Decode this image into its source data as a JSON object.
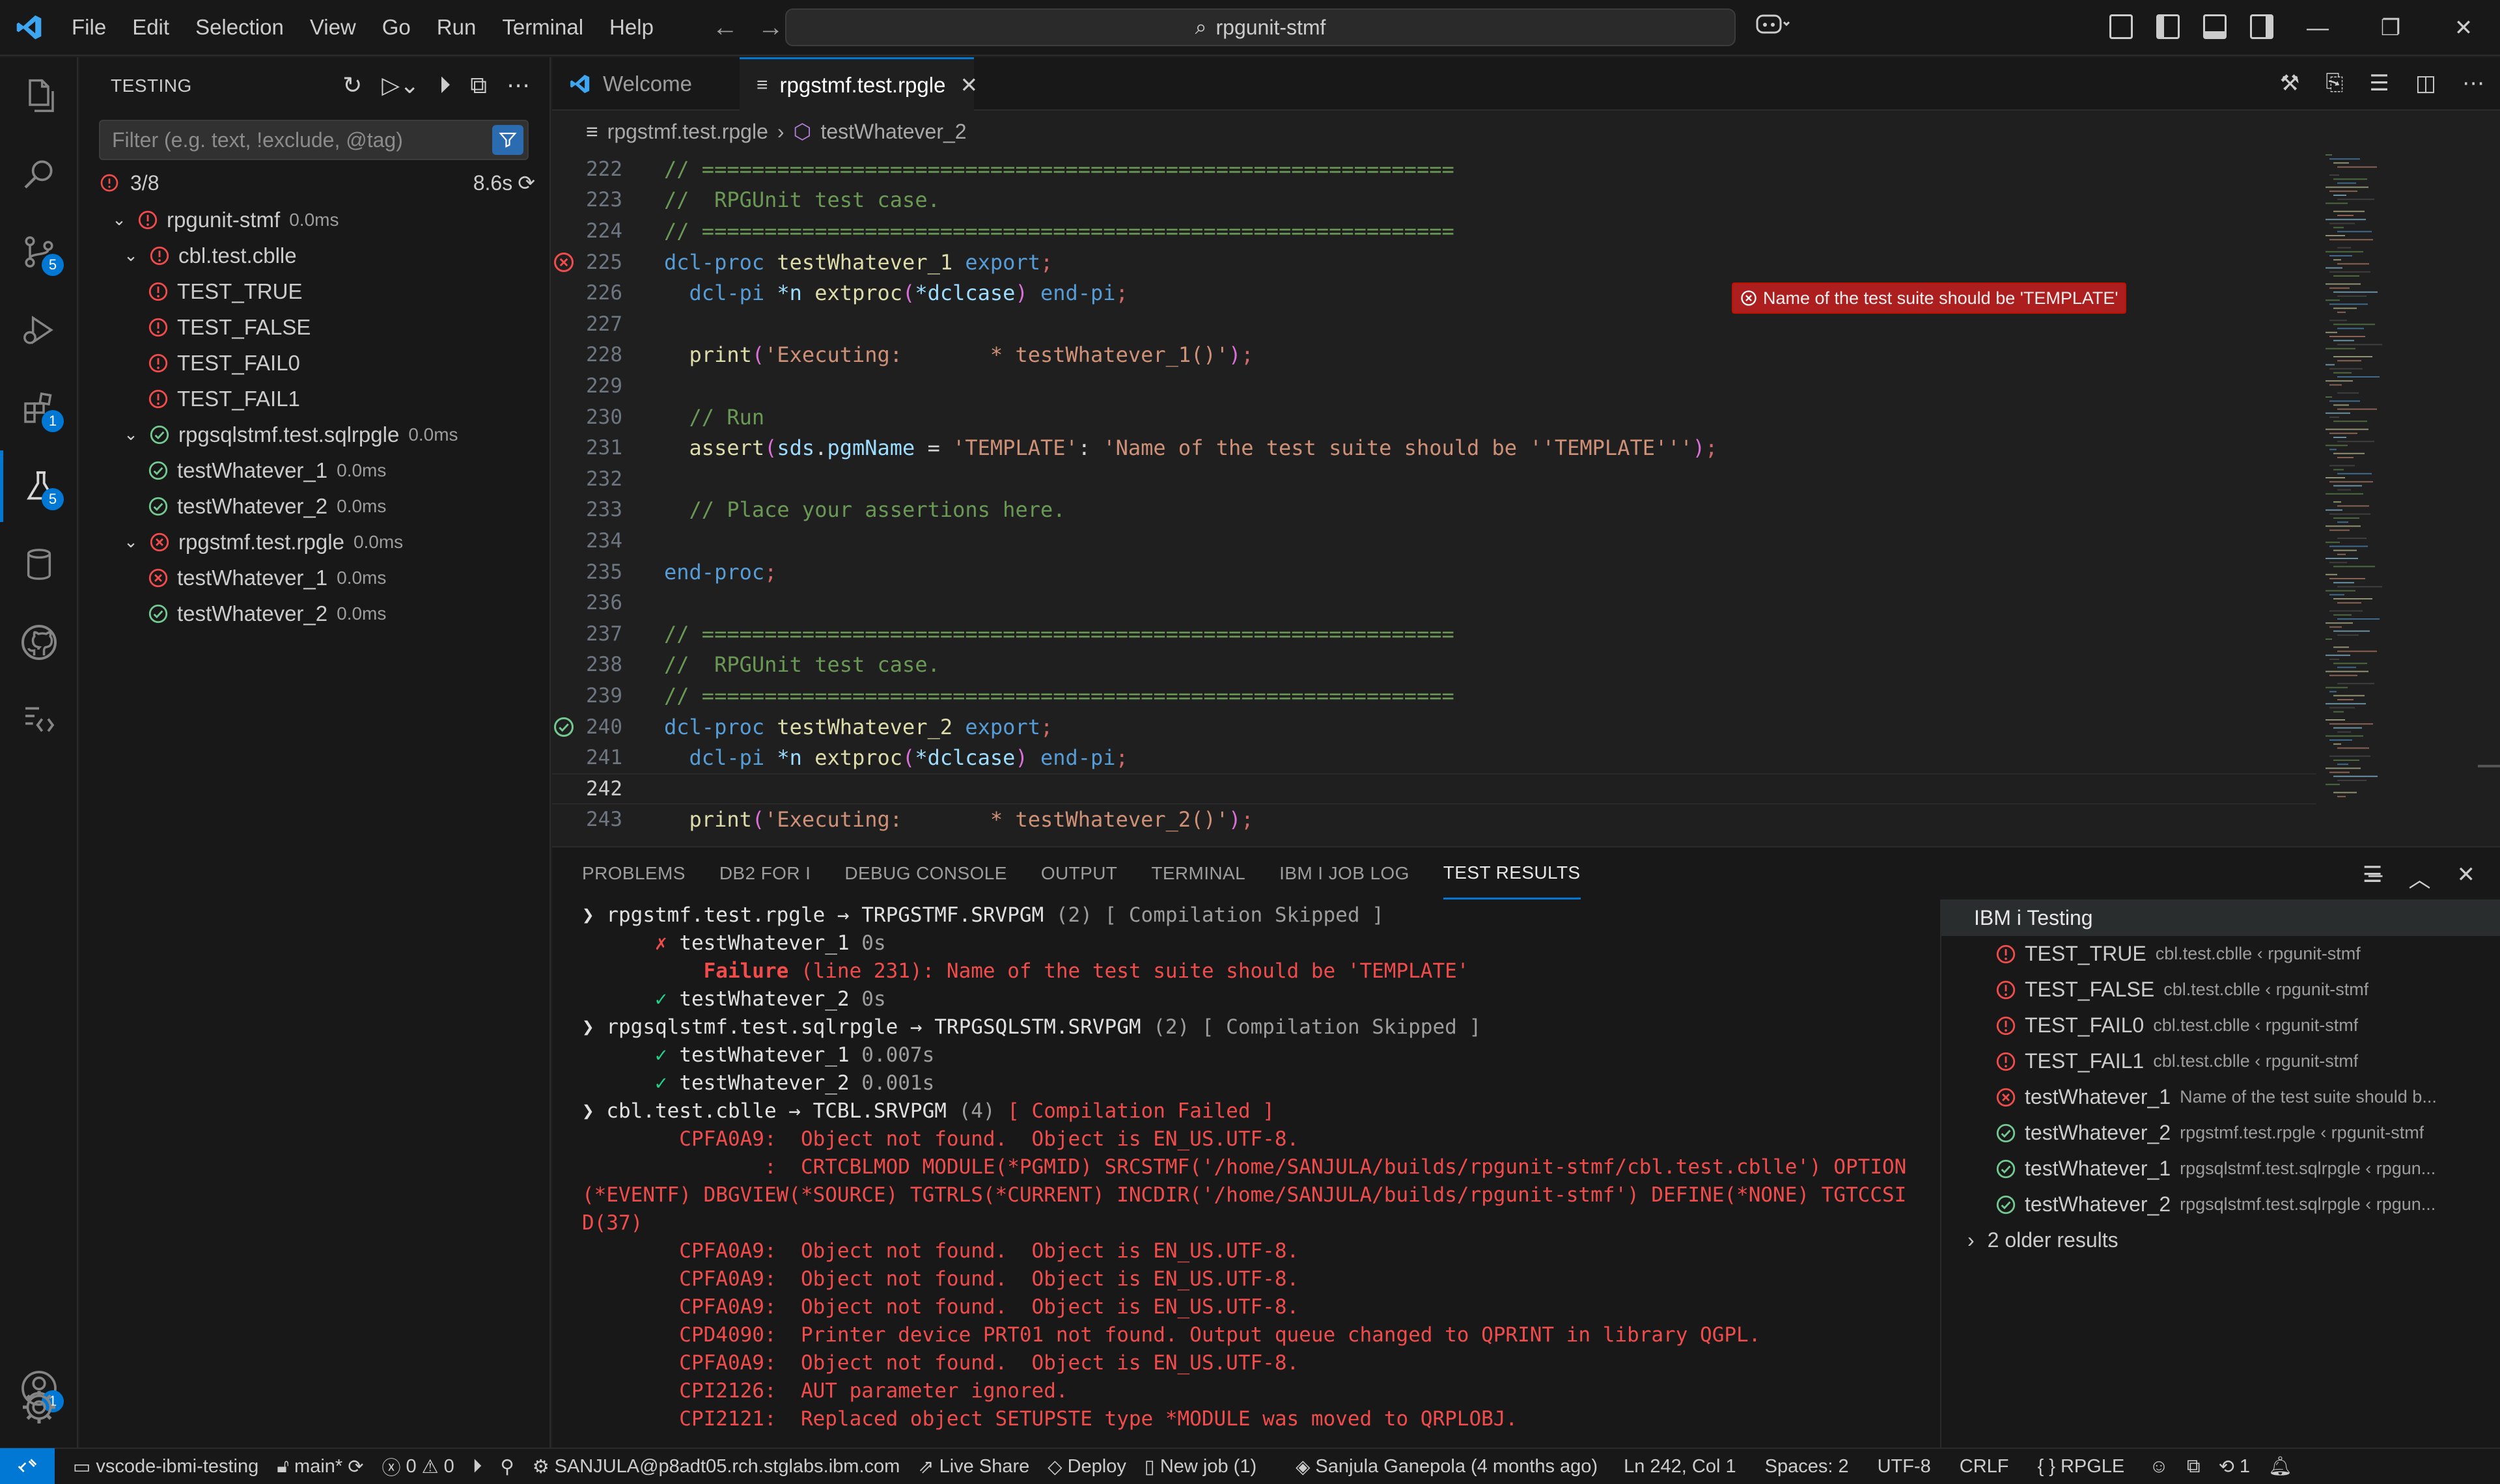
{
  "titlebar": {
    "menu": [
      "File",
      "Edit",
      "Selection",
      "View",
      "Go",
      "Run",
      "Terminal",
      "Help"
    ],
    "search": "rpgunit-stmf"
  },
  "activity": {
    "badges": {
      "scm": "5",
      "extensions": "1",
      "testing": "5",
      "accounts": "1"
    }
  },
  "sidebar": {
    "title": "TESTING",
    "filter_placeholder": "Filter (e.g. text, !exclude, @tag)",
    "summary_count": "3/8",
    "summary_time": "8.6s",
    "tree": [
      {
        "label": "rpgunit-stmf",
        "dur": "0.0ms",
        "status": "error",
        "level": 0,
        "chev": "v"
      },
      {
        "label": "cbl.test.cblle",
        "dur": "",
        "status": "error",
        "level": 1,
        "chev": "v"
      },
      {
        "label": "TEST_TRUE",
        "dur": "",
        "status": "error",
        "level": 2,
        "chev": ""
      },
      {
        "label": "TEST_FALSE",
        "dur": "",
        "status": "error",
        "level": 2,
        "chev": ""
      },
      {
        "label": "TEST_FAIL0",
        "dur": "",
        "status": "error",
        "level": 2,
        "chev": ""
      },
      {
        "label": "TEST_FAIL1",
        "dur": "",
        "status": "error",
        "level": 2,
        "chev": ""
      },
      {
        "label": "rpgsqlstmf.test.sqlrpgle",
        "dur": "0.0ms",
        "status": "pass",
        "level": 1,
        "chev": "v"
      },
      {
        "label": "testWhatever_1",
        "dur": "0.0ms",
        "status": "pass",
        "level": 2,
        "chev": ""
      },
      {
        "label": "testWhatever_2",
        "dur": "0.0ms",
        "status": "pass",
        "level": 2,
        "chev": ""
      },
      {
        "label": "rpgstmf.test.rpgle",
        "dur": "0.0ms",
        "status": "fail",
        "level": 1,
        "chev": "v"
      },
      {
        "label": "testWhatever_1",
        "dur": "0.0ms",
        "status": "fail",
        "level": 2,
        "chev": ""
      },
      {
        "label": "testWhatever_2",
        "dur": "0.0ms",
        "status": "pass",
        "level": 2,
        "chev": ""
      }
    ]
  },
  "editor": {
    "tabs": [
      {
        "label": "Welcome"
      },
      {
        "label": "rpgstmf.test.rpgle"
      }
    ],
    "breadcrumb": [
      "rpgstmf.test.rpgle",
      "testWhatever_2"
    ],
    "inline_error": "Name of the test suite should be 'TEMPLATE'",
    "lines": [
      {
        "n": "222",
        "html": "<span class='c-com'>// ============================================================</span>"
      },
      {
        "n": "223",
        "html": "<span class='c-com'>//  RPGUnit test case.</span>"
      },
      {
        "n": "224",
        "html": "<span class='c-com'>// ============================================================</span>"
      },
      {
        "n": "225",
        "html": "<span class='c-kw'>dcl-proc</span> <span class='c-fn'>testWhatever_1</span> <span class='c-kw'>export</span><span class='c-semicolon'>;</span>",
        "mark": "fail"
      },
      {
        "n": "226",
        "html": "  <span class='c-kw'>dcl-pi</span> <span class='c-var'>*n</span> <span class='c-fn'>extproc</span><span class='c-p2'>(</span><span class='c-var'>*dclcase</span><span class='c-p2'>)</span> <span class='c-kw'>end-pi</span><span class='c-semicolon'>;</span>"
      },
      {
        "n": "227",
        "html": ""
      },
      {
        "n": "228",
        "html": "  <span class='c-fn'>print</span><span class='c-p2'>(</span><span class='c-str'>'Executing:       * testWhatever_1()'</span><span class='c-p2'>)</span><span class='c-semicolon'>;</span>"
      },
      {
        "n": "229",
        "html": ""
      },
      {
        "n": "230",
        "html": "  <span class='c-com'>// Run</span>"
      },
      {
        "n": "231",
        "html": "  <span class='c-fn'>assert</span><span class='c-p2'>(</span><span class='c-var'>sds</span><span class='c-punc'>.</span><span class='c-var'>pgmName</span> <span class='c-punc'>=</span> <span class='c-str'>'TEMPLATE'</span><span class='c-punc'>:</span> <span class='c-str'>'Name of the test suite should be ''TEMPLATE'''</span><span class='c-p2'>)</span><span class='c-semicolon'>;</span>"
      },
      {
        "n": "232",
        "html": ""
      },
      {
        "n": "233",
        "html": "  <span class='c-com'>// Place your assertions here.</span>"
      },
      {
        "n": "234",
        "html": ""
      },
      {
        "n": "235",
        "html": "<span class='c-kw'>end-proc</span><span class='c-semicolon'>;</span>"
      },
      {
        "n": "236",
        "html": ""
      },
      {
        "n": "237",
        "html": "<span class='c-com'>// ============================================================</span>"
      },
      {
        "n": "238",
        "html": "<span class='c-com'>//  RPGUnit test case.</span>"
      },
      {
        "n": "239",
        "html": "<span class='c-com'>// ============================================================</span>"
      },
      {
        "n": "240",
        "html": "<span class='c-kw'>dcl-proc</span> <span class='c-fn'>testWhatever_2</span> <span class='c-kw'>export</span><span class='c-semicolon'>;</span>",
        "mark": "pass"
      },
      {
        "n": "241",
        "html": "  <span class='c-kw'>dcl-pi</span> <span class='c-var'>*n</span> <span class='c-fn'>extproc</span><span class='c-p2'>(</span><span class='c-var'>*dclcase</span><span class='c-p2'>)</span> <span class='c-kw'>end-pi</span><span class='c-semicolon'>;</span>"
      },
      {
        "n": "242",
        "html": "",
        "current": true
      },
      {
        "n": "243",
        "html": "  <span class='c-fn'>print</span><span class='c-p2'>(</span><span class='c-str'>'Executing:       * testWhatever_2()'</span><span class='c-p2'>)</span><span class='c-semicolon'>;</span>"
      }
    ]
  },
  "panel": {
    "tabs": [
      "PROBLEMS",
      "DB2 FOR I",
      "DEBUG CONSOLE",
      "OUTPUT",
      "TERMINAL",
      "IBM I JOB LOG",
      "TEST RESULTS"
    ],
    "active_tab": "TEST RESULTS",
    "results": [
      {
        "html": "<span class='r-white'>❯ rpgstmf.test.rpgle → TRPGSTMF.SRVPGM </span><span class='r-dim'>(2) [ Compilation Skipped ]</span>"
      },
      {
        "html": "<span class='r-red'>      ✗ </span><span class='r-white'>testWhatever_1 </span><span class='r-dim'>0s</span>"
      },
      {
        "html": "<span class='r-bred'>          Failure</span><span class='r-red'> (line 231): Name of the test suite should be 'TEMPLATE'</span>"
      },
      {
        "html": "<span class='r-green'>      ✓ </span><span class='r-white'>testWhatever_2 </span><span class='r-dim'>0s</span>"
      },
      {
        "html": "<span class='r-white'>❯ rpgsqlstmf.test.sqlrpgle → TRPGSQLSTM.SRVPGM </span><span class='r-dim'>(2) [ Compilation Skipped ]</span>"
      },
      {
        "html": "<span class='r-green'>      ✓ </span><span class='r-white'>testWhatever_1 </span><span class='r-dim'>0.007s</span>"
      },
      {
        "html": "<span class='r-green'>      ✓ </span><span class='r-white'>testWhatever_2 </span><span class='r-dim'>0.001s</span>"
      },
      {
        "html": "<span class='r-white'>❯ cbl.test.cblle → TCBL.SRVPGM </span><span class='r-dim'>(4) </span><span class='r-red'>[ Compilation Failed ]</span>"
      },
      {
        "html": "<span class='r-red'>        CPFA0A9:  Object not found.  Object is EN_US.UTF-8.</span>"
      },
      {
        "html": "<span class='r-red'>               :  CRTCBLMOD MODULE(*PGMID) SRCSTMF('/home/SANJULA/builds/rpgunit-stmf/cbl.test.cblle') OPTION</span>"
      },
      {
        "html": "<span class='r-red'>(*EVENTF) DBGVIEW(*SOURCE) TGTRLS(*CURRENT) INCDIR('/home/SANJULA/builds/rpgunit-stmf') DEFINE(*NONE) TGTCCSI</span>"
      },
      {
        "html": "<span class='r-red'>D(37)</span>"
      },
      {
        "html": "<span class='r-red'>        CPFA0A9:  Object not found.  Object is EN_US.UTF-8.</span>"
      },
      {
        "html": "<span class='r-red'>        CPFA0A9:  Object not found.  Object is EN_US.UTF-8.</span>"
      },
      {
        "html": "<span class='r-red'>        CPFA0A9:  Object not found.  Object is EN_US.UTF-8.</span>"
      },
      {
        "html": "<span class='r-red'>        CPD4090:  Printer device PRT01 not found. Output queue changed to QPRINT in library QGPL.</span>"
      },
      {
        "html": "<span class='r-red'>        CPFA0A9:  Object not found.  Object is EN_US.UTF-8.</span>"
      },
      {
        "html": "<span class='r-red'>        CPI2126:  AUT parameter ignored.</span>"
      },
      {
        "html": "<span class='r-red'>        CPI2121:  Replaced object SETUPSTE type *MODULE was moved to QRPLOBJ.</span>"
      }
    ],
    "side": {
      "header": "IBM i Testing",
      "items": [
        {
          "label": "TEST_TRUE",
          "sub": "cbl.test.cblle ‹ rpgunit-stmf",
          "status": "error"
        },
        {
          "label": "TEST_FALSE",
          "sub": "cbl.test.cblle ‹ rpgunit-stmf",
          "status": "error"
        },
        {
          "label": "TEST_FAIL0",
          "sub": "cbl.test.cblle ‹ rpgunit-stmf",
          "status": "error"
        },
        {
          "label": "TEST_FAIL1",
          "sub": "cbl.test.cblle ‹ rpgunit-stmf",
          "status": "error"
        },
        {
          "label": "testWhatever_1",
          "sub": "Name of the test suite should b...",
          "status": "fail"
        },
        {
          "label": "testWhatever_2",
          "sub": "rpgstmf.test.rpgle ‹ rpgunit-stmf",
          "status": "pass"
        },
        {
          "label": "testWhatever_1",
          "sub": "rpgsqlstmf.test.sqlrpgle ‹ rpgun...",
          "status": "pass"
        },
        {
          "label": "testWhatever_2",
          "sub": "rpgsqlstmf.test.sqlrpgle ‹ rpgun...",
          "status": "pass"
        }
      ],
      "older": "2 older results"
    }
  },
  "statusbar": {
    "repo": "vscode-ibmi-testing",
    "branch": "main*",
    "errors": "0",
    "warnings": "0",
    "connection": "SANJULA@p8adt05.rch.stglabs.ibm.com",
    "liveshare": "Live Share",
    "deploy": "Deploy",
    "newjob": "New job (1)",
    "blame": "Sanjula Ganepola (4 months ago)",
    "position": "Ln 242, Col 1",
    "spaces": "Spaces: 2",
    "encoding": "UTF-8",
    "eol": "CRLF",
    "language": "RPGLE",
    "notifications": "1"
  },
  "colors": {
    "accent": "#0078d4",
    "error": "#f14c4c",
    "pass": "#73c991"
  }
}
